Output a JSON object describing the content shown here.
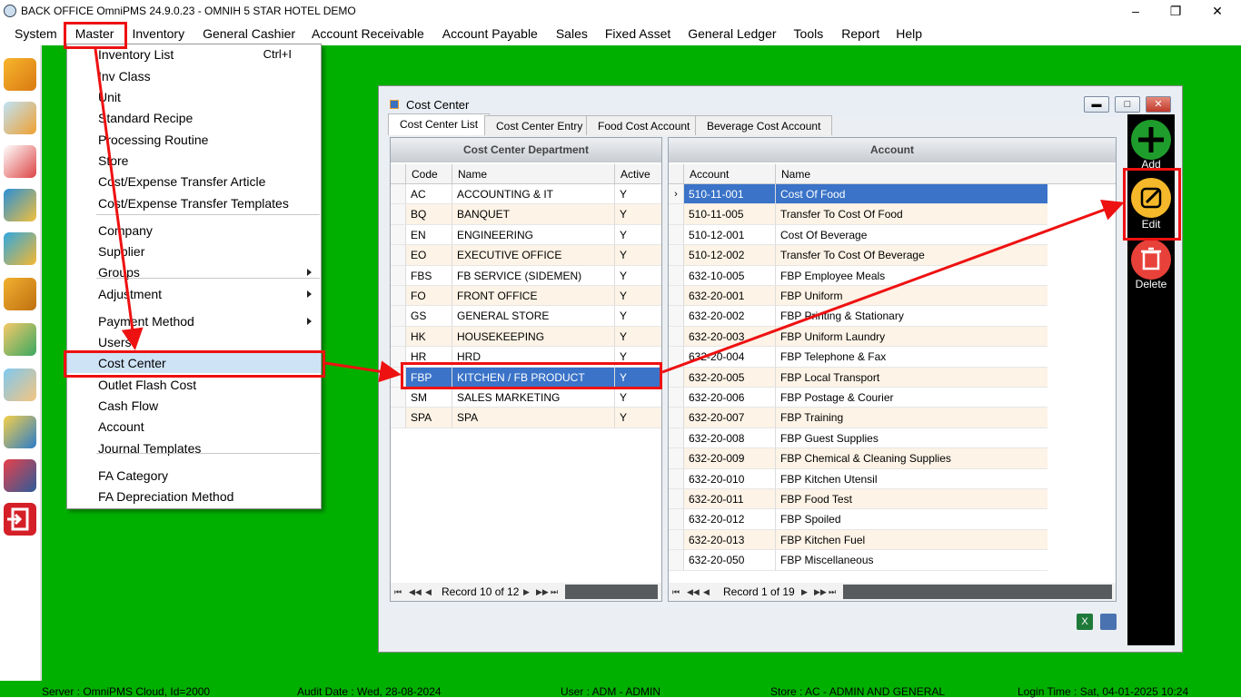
{
  "window": {
    "title": "BACK OFFICE OmniPMS 24.9.0.23 - OMNIH 5 STAR HOTEL DEMO",
    "controls": [
      "–",
      "❐",
      "✕"
    ]
  },
  "menubar": [
    "System",
    "Master",
    "Inventory",
    "General Cashier",
    "Account Receivable",
    "Account Payable",
    "Sales",
    "Fixed Asset",
    "General Ledger",
    "Tools",
    "Report",
    "Help"
  ],
  "master_menu": [
    {
      "label": "Inventory List",
      "shortcut": "Ctrl+I"
    },
    {
      "label": "Inv Class"
    },
    {
      "label": "Unit"
    },
    {
      "label": "Standard Recipe"
    },
    {
      "label": "Processing Routine"
    },
    {
      "label": "Store"
    },
    {
      "label": "Cost/Expense Transfer Article"
    },
    {
      "label": "Cost/Expense Transfer Templates"
    },
    {
      "label": "Company"
    },
    {
      "label": "Supplier"
    },
    {
      "label": "Groups",
      "submenu": true
    },
    {
      "label": "Adjustment",
      "submenu": true
    },
    {
      "label": "Payment Method",
      "submenu": true
    },
    {
      "label": "Users"
    },
    {
      "label": "Cost Center",
      "highlighted": true
    },
    {
      "label": "Outlet Flash Cost"
    },
    {
      "label": "Cash Flow"
    },
    {
      "label": "Account"
    },
    {
      "label": "Journal Templates"
    },
    {
      "label": "FA Category"
    },
    {
      "label": "FA Depreciation Method"
    }
  ],
  "cost_center": {
    "title": "Cost Center",
    "tabs": [
      "Cost Center List",
      "Cost Center Entry",
      "Food Cost Account",
      "Beverage Cost Account"
    ],
    "department_panel": {
      "header": "Cost Center Department",
      "columns": [
        "Code",
        "Name",
        "Active"
      ],
      "rows": [
        [
          "AC",
          "ACCOUNTING & IT",
          "Y"
        ],
        [
          "BQ",
          "BANQUET",
          "Y"
        ],
        [
          "EN",
          "ENGINEERING",
          "Y"
        ],
        [
          "EO",
          "EXECUTIVE OFFICE",
          "Y"
        ],
        [
          "FBS",
          "FB SERVICE (SIDEMEN)",
          "Y"
        ],
        [
          "FO",
          "FRONT OFFICE",
          "Y"
        ],
        [
          "GS",
          "GENERAL STORE",
          "Y"
        ],
        [
          "HK",
          "HOUSEKEEPING",
          "Y"
        ],
        [
          "HR",
          "HRD",
          "Y"
        ],
        [
          "FBP",
          "KITCHEN / FB PRODUCT",
          "Y"
        ],
        [
          "SM",
          "SALES MARKETING",
          "Y"
        ],
        [
          "SPA",
          "SPA",
          "Y"
        ]
      ],
      "selected_row": 9,
      "record_text": "Record 10 of 12"
    },
    "account_panel": {
      "header": "Account",
      "columns": [
        "Account",
        "Name"
      ],
      "rows": [
        [
          "510-11-001",
          "Cost Of Food"
        ],
        [
          "510-11-005",
          "Transfer To Cost Of Food"
        ],
        [
          "510-12-001",
          "Cost Of Beverage"
        ],
        [
          "510-12-002",
          "Transfer To Cost Of Beverage"
        ],
        [
          "632-10-005",
          "FBP Employee Meals"
        ],
        [
          "632-20-001",
          "FBP Uniform"
        ],
        [
          "632-20-002",
          "FBP Printing & Stationary"
        ],
        [
          "632-20-003",
          "FBP Uniform Laundry"
        ],
        [
          "632-20-004",
          "FBP Telephone & Fax"
        ],
        [
          "632-20-005",
          "FBP Local Transport"
        ],
        [
          "632-20-006",
          "FBP Postage & Courier"
        ],
        [
          "632-20-007",
          "FBP Training"
        ],
        [
          "632-20-008",
          "FBP Guest Supplies"
        ],
        [
          "632-20-009",
          "FBP Chemical & Cleaning Supplies"
        ],
        [
          "632-20-010",
          "FBP Kitchen Utensil"
        ],
        [
          "632-20-011",
          "FBP Food Test"
        ],
        [
          "632-20-012",
          "FBP Spoiled"
        ],
        [
          "632-20-013",
          "FBP Kitchen Fuel"
        ],
        [
          "632-20-050",
          "FBP Miscellaneous"
        ]
      ],
      "selected_row": 0,
      "record_text": "Record 1 of 19"
    },
    "actions": {
      "add": "Add",
      "edit": "Edit",
      "delete": "Delete"
    }
  },
  "status": {
    "server": "Server : OmniPMS Cloud, Id=2000",
    "audit": "Audit Date : Wed, 28-08-2024",
    "user": "User : ADM - ADMIN",
    "store": "Store : AC - ADMIN AND GENERAL",
    "login": "Login Time : Sat, 04-01-2025 10:24"
  },
  "colors": {
    "desktop": "#00b000",
    "highlight": "#ee1111",
    "selection": "#3a73c8"
  }
}
